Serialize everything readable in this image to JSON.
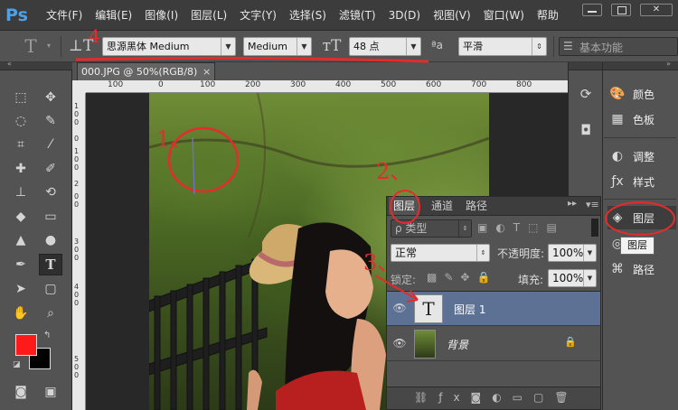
{
  "app": {
    "logo": "Ps"
  },
  "menu": [
    "文件(F)",
    "编辑(E)",
    "图像(I)",
    "图层(L)",
    "文字(Y)",
    "选择(S)",
    "滤镜(T)",
    "3D(D)",
    "视图(V)",
    "窗口(W)",
    "帮助"
  ],
  "window": {
    "close_label": "✕"
  },
  "options": {
    "font_family": "思源黑体 Medium",
    "font_style": "Medium",
    "font_size": "48 点",
    "aa_glyph": "ªa",
    "antialias": "平滑",
    "workspace": "基本功能"
  },
  "document": {
    "tab_title": "000.JPG @ 50%(RGB/8)",
    "tab_close": "×",
    "ruler_top": [
      "100",
      "0",
      "100",
      "200",
      "300",
      "400",
      "500",
      "600",
      "700",
      "800"
    ],
    "ruler_left": [
      "1",
      "0",
      "0",
      "0",
      "1",
      "0",
      "0",
      "2",
      "0",
      "0",
      "3",
      "0",
      "0",
      "4",
      "0",
      "0",
      "5",
      "0",
      "0"
    ]
  },
  "layers_panel": {
    "tabs": [
      "图层",
      "通道",
      "路径"
    ],
    "filter_label": "ρ 类型",
    "blend_mode": "正常",
    "opacity_label": "不透明度:",
    "opacity_value": "100%",
    "lock_label": "锁定:",
    "fill_label": "填充:",
    "fill_value": "100%",
    "layers": [
      {
        "name": "图层 1",
        "thumb_glyph": "T",
        "selected": true
      },
      {
        "name": "背景",
        "locked": true
      }
    ]
  },
  "right_panels": {
    "items": [
      "颜色",
      "色板",
      "调整",
      "样式",
      "图层",
      "通道",
      "路径"
    ],
    "tooltip": "图层"
  },
  "annotations": [
    "1、",
    "2、",
    "3、",
    "4"
  ],
  "colors": {
    "foreground": "#ff1a1a",
    "background": "#000000",
    "annotation": "#e52b2b",
    "selected_layer": "#5d7194"
  }
}
